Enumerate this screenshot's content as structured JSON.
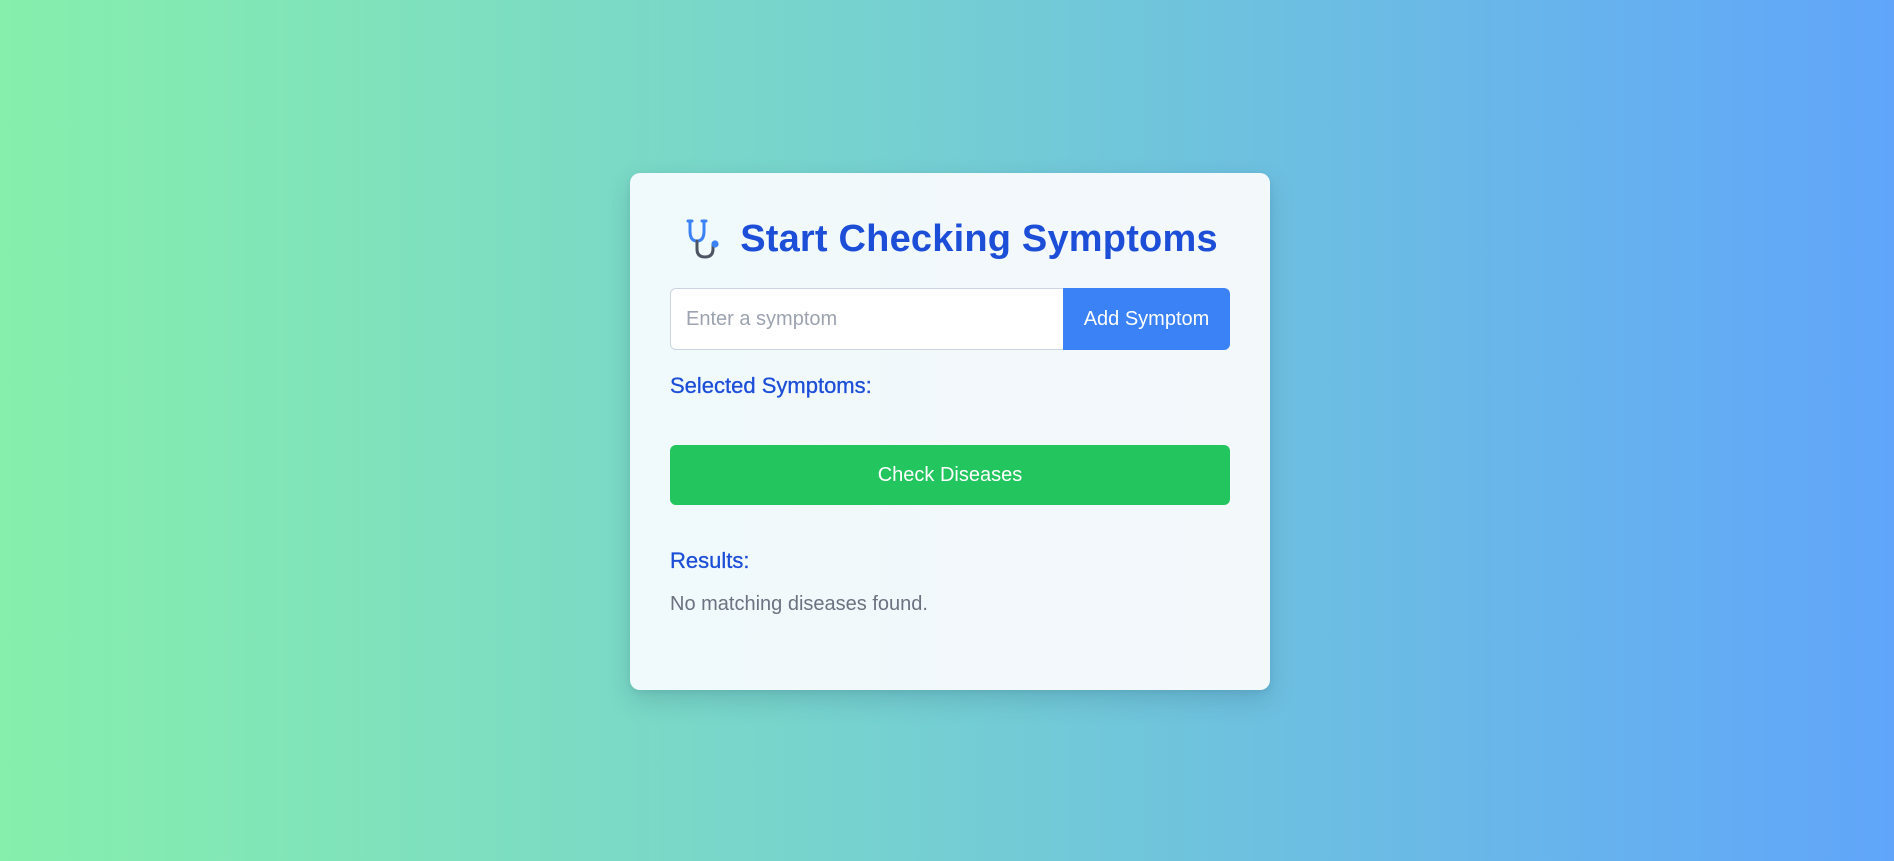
{
  "header": {
    "icon": "stethoscope-icon",
    "title": "Start Checking Symptoms"
  },
  "symptom_input": {
    "placeholder": "Enter a symptom",
    "value": ""
  },
  "add_button": {
    "label": "Add Symptom"
  },
  "selected": {
    "heading": "Selected Symptoms:",
    "items": []
  },
  "check_button": {
    "label": "Check Diseases"
  },
  "results": {
    "heading": "Results:",
    "message": "No matching diseases found."
  },
  "colors": {
    "primary_blue": "#3b82f6",
    "heading_blue": "#1d4ed8",
    "action_green": "#22c55e",
    "muted_text": "#6b7280",
    "bg_gradient_start": "#86efac",
    "bg_gradient_end": "#60a5fa"
  }
}
